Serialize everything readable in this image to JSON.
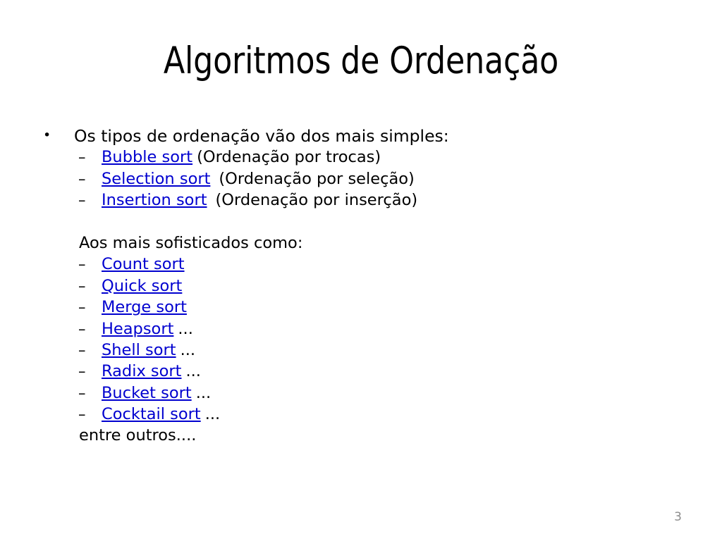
{
  "slide": {
    "title": "Algoritmos de Ordenação",
    "page_number": "3",
    "link_color": "#0000CF",
    "text_color": "#000000",
    "page_number_color": "#8C8C8C",
    "background_color": "#FFFFFF"
  },
  "content": {
    "intro_bullet": "Os tipos de ordenação vão dos mais simples:",
    "bullet_marker": "•",
    "dash_marker": "–",
    "simple_sorts": [
      {
        "link": "Bubble sort",
        "note": "(Ordenação por trocas)",
        "wide_gap": false
      },
      {
        "link": "Selection sort",
        "note": "(Ordenação por seleção)",
        "wide_gap": true
      },
      {
        "link": "Insertion sort",
        "note": "(Ordenação por inserção)",
        "wide_gap": true
      }
    ],
    "advanced_heading": "Aos mais sofisticados como:",
    "advanced_sorts": [
      {
        "link": "Count sort",
        "note": ""
      },
      {
        "link": "Quick sort",
        "note": ""
      },
      {
        "link": "Merge sort",
        "note": ""
      },
      {
        "link": "Heapsort",
        "note": "..."
      },
      {
        "link": "Shell sort",
        "note": "..."
      },
      {
        "link": "Radix sort",
        "note": "..."
      },
      {
        "link": "Bucket sort",
        "note": "..."
      },
      {
        "link": "Cocktail sort",
        "note": "..."
      }
    ],
    "closing": "entre outros...."
  }
}
